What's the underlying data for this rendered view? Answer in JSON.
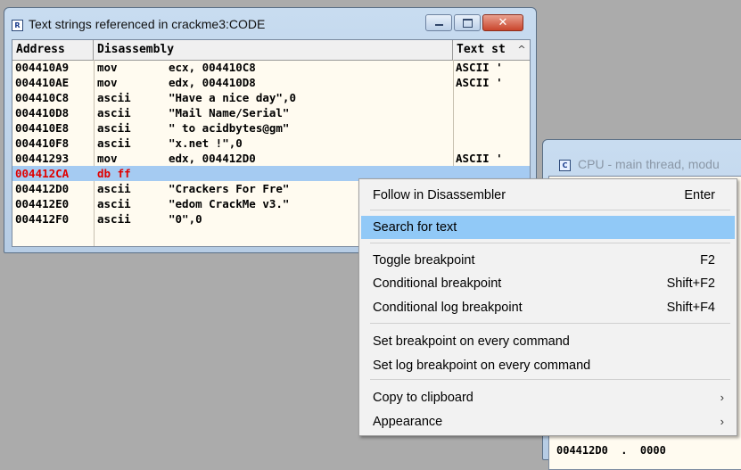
{
  "strings_window": {
    "title": "Text strings referenced in crackme3:CODE",
    "app_icon": "R",
    "columns": [
      "Address",
      "Disassembly",
      "Text st"
    ],
    "rows": [
      {
        "addr": "004410A9",
        "mnem": "mov",
        "op": "ecx, 004410C8",
        "text": "ASCII '"
      },
      {
        "addr": "004410AE",
        "mnem": "mov",
        "op": "edx, 004410D8",
        "text": "ASCII '"
      },
      {
        "addr": "004410C8",
        "mnem": "ascii",
        "op": "\"Have a nice day\",0",
        "text": ""
      },
      {
        "addr": "004410D8",
        "mnem": "ascii",
        "op": "\"Mail Name/Serial\"",
        "text": ""
      },
      {
        "addr": "004410E8",
        "mnem": "ascii",
        "op": "\" to acidbytes@gm\"",
        "text": ""
      },
      {
        "addr": "004410F8",
        "mnem": "ascii",
        "op": "\"x.net !\",0",
        "text": ""
      },
      {
        "addr": "00441293",
        "mnem": "mov",
        "op": "edx, 004412D0",
        "text": "ASCII '"
      },
      {
        "addr": "004412CA",
        "mnem": "db ff",
        "op": "",
        "text": ""
      },
      {
        "addr": "004412D0",
        "mnem": "ascii",
        "op": "\"Crackers For Fre\"",
        "text": ""
      },
      {
        "addr": "004412E0",
        "mnem": "ascii",
        "op": "\"edom CrackMe v3.\"",
        "text": ""
      },
      {
        "addr": "004412F0",
        "mnem": "ascii",
        "op": "\"0\",0",
        "text": ""
      }
    ],
    "selected_row_index": 7,
    "scroll_up_glyph": "^"
  },
  "cpu_window": {
    "title": "CPU - main thread, modu",
    "app_icon": "C",
    "bottom_row": "004412D0  .  0000"
  },
  "context_menu": {
    "items": [
      {
        "label": "Follow in Disassembler",
        "shortcut": "Enter"
      },
      {
        "label": "Search for text",
        "shortcut": "",
        "highlighted": true
      },
      {
        "label": "Toggle breakpoint",
        "shortcut": "F2"
      },
      {
        "label": "Conditional breakpoint",
        "shortcut": "Shift+F2"
      },
      {
        "label": "Conditional log breakpoint",
        "shortcut": "Shift+F4"
      },
      {
        "label": "Set breakpoint on every command",
        "shortcut": ""
      },
      {
        "label": "Set log breakpoint on every command",
        "shortcut": ""
      },
      {
        "label": "Copy to clipboard",
        "shortcut": "",
        "submenu": true
      },
      {
        "label": "Appearance",
        "shortcut": "",
        "submenu": true
      }
    ],
    "submenu_glyph": "›"
  }
}
